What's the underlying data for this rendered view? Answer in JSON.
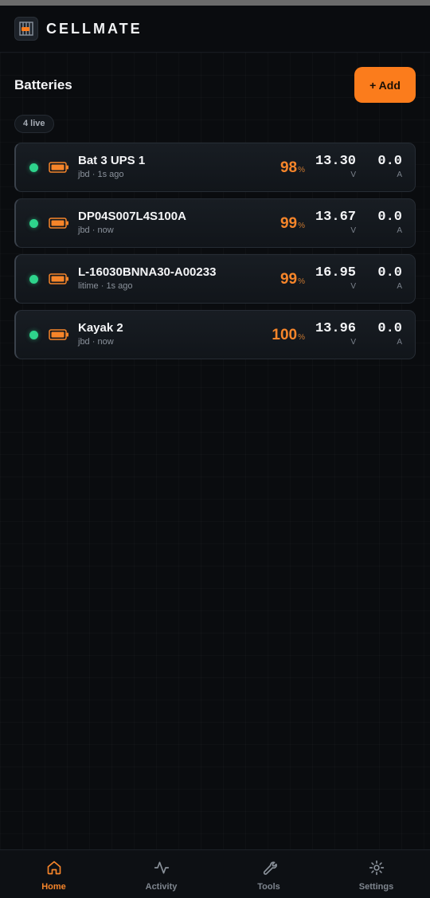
{
  "app": {
    "title": "CELLMATE"
  },
  "section": {
    "title": "Batteries",
    "add_label": "+ Add",
    "live_badge": "4 live"
  },
  "batteries": [
    {
      "name": "Bat 3 UPS 1",
      "sub": "jbd · 1s ago",
      "percent": "98",
      "voltage": "13.30",
      "current": "0.0"
    },
    {
      "name": "DP04S007L4S100A",
      "sub": "jbd · now",
      "percent": "99",
      "voltage": "13.67",
      "current": "0.0"
    },
    {
      "name": "L-16030BNNA30-A00233",
      "sub": "litime · 1s ago",
      "percent": "99",
      "voltage": "16.95",
      "current": "0.0"
    },
    {
      "name": "Kayak 2",
      "sub": "jbd · now",
      "percent": "100",
      "voltage": "13.96",
      "current": "0.0"
    }
  ],
  "units": {
    "percent": "%",
    "voltage": "V",
    "current": "A"
  },
  "nav": [
    {
      "label": "Home",
      "icon": "home-icon",
      "active": true
    },
    {
      "label": "Activity",
      "icon": "activity-icon",
      "active": false
    },
    {
      "label": "Tools",
      "icon": "wrench-icon",
      "active": false
    },
    {
      "label": "Settings",
      "icon": "gear-icon",
      "active": false
    }
  ],
  "colors": {
    "accent": "#fb7c1c",
    "online": "#2ed48c",
    "background": "#0a0c0f"
  }
}
